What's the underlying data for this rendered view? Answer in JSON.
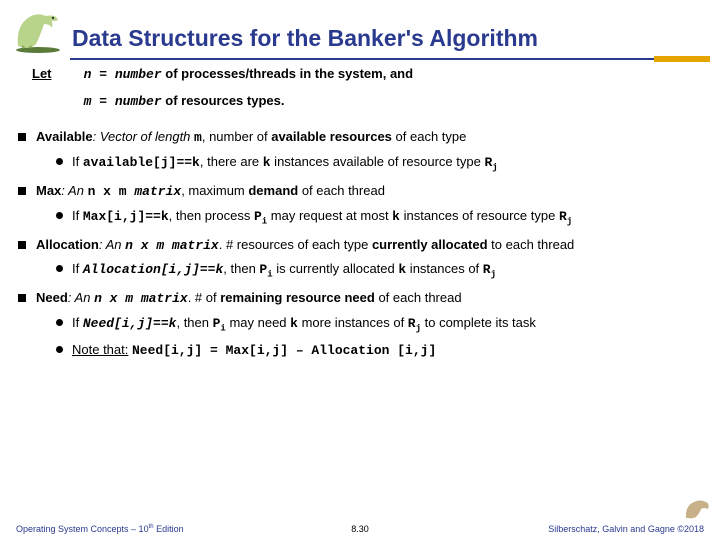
{
  "title": "Data Structures for the Banker's Algorithm",
  "let": {
    "label": "Let",
    "line1_pre": "n = number",
    "line1_post": " of processes/threads in the system, and",
    "line2_pre": "m = number",
    "line2_post": " of resources types."
  },
  "b1": {
    "name": "Available",
    "rest1": ": Vector of length ",
    "m": "m",
    "rest2": ", number of ",
    "bold": "available resources",
    "rest3": " of each type",
    "sub_pre": "If ",
    "sub_code": "available[j]==k",
    "sub_mid": ", there are ",
    "k": "k",
    "sub_mid2": " instances available of resource type ",
    "R": "R",
    "j": "j"
  },
  "b2": {
    "name": "Max",
    "rest1": ": An ",
    "nxm": "n x m",
    "matrix": " matrix",
    "rest2": ", maximum ",
    "bold": "demand",
    "rest3": " of each thread",
    "sub_pre": "If ",
    "sub_code": "Max[i,j]==k",
    "sub_mid": ", then process ",
    "P": "P",
    "i": "i",
    "sub_mid2": " may request at most ",
    "k": "k",
    "sub_mid3": " instances of resource type ",
    "R": "R",
    "j": "j"
  },
  "b3": {
    "name": "Allocation",
    "rest1": ": An ",
    "nxm": "n x m matrix",
    "rest2": ". # resources of each type ",
    "bold": "currently allocated",
    "rest3": " to each thread",
    "sub_pre": "If ",
    "sub_code": "Allocation[i,j]==k",
    "sub_mid": ", then ",
    "P": "P",
    "i": "i",
    "sub_mid2": " is currently allocated ",
    "k": "k",
    "sub_mid3": " instances of ",
    "R": "R",
    "j": "j"
  },
  "b4": {
    "name": "Need",
    "rest1": ": An ",
    "nxm": "n x m matrix",
    "rest2": ". # of ",
    "bold": "remaining resource need",
    "rest3": " of each thread",
    "sub_pre": "If ",
    "sub_code": "Need[i,j]==k",
    "sub_mid": ", then ",
    "P": "P",
    "i": "i",
    "sub_mid2": " may need ",
    "k": "k",
    "sub_mid3": " more instances of ",
    "R": "R",
    "j": "j",
    "sub_mid4": " to complete its task",
    "note_label": "Note that:",
    "note_code": "Need[i,j] = Max[i,j] – Allocation [i,j]"
  },
  "footer": {
    "left": "Operating System Concepts – 10th Edition",
    "mid": "8.30",
    "right": "Silberschatz, Galvin and Gagne ©2018"
  }
}
